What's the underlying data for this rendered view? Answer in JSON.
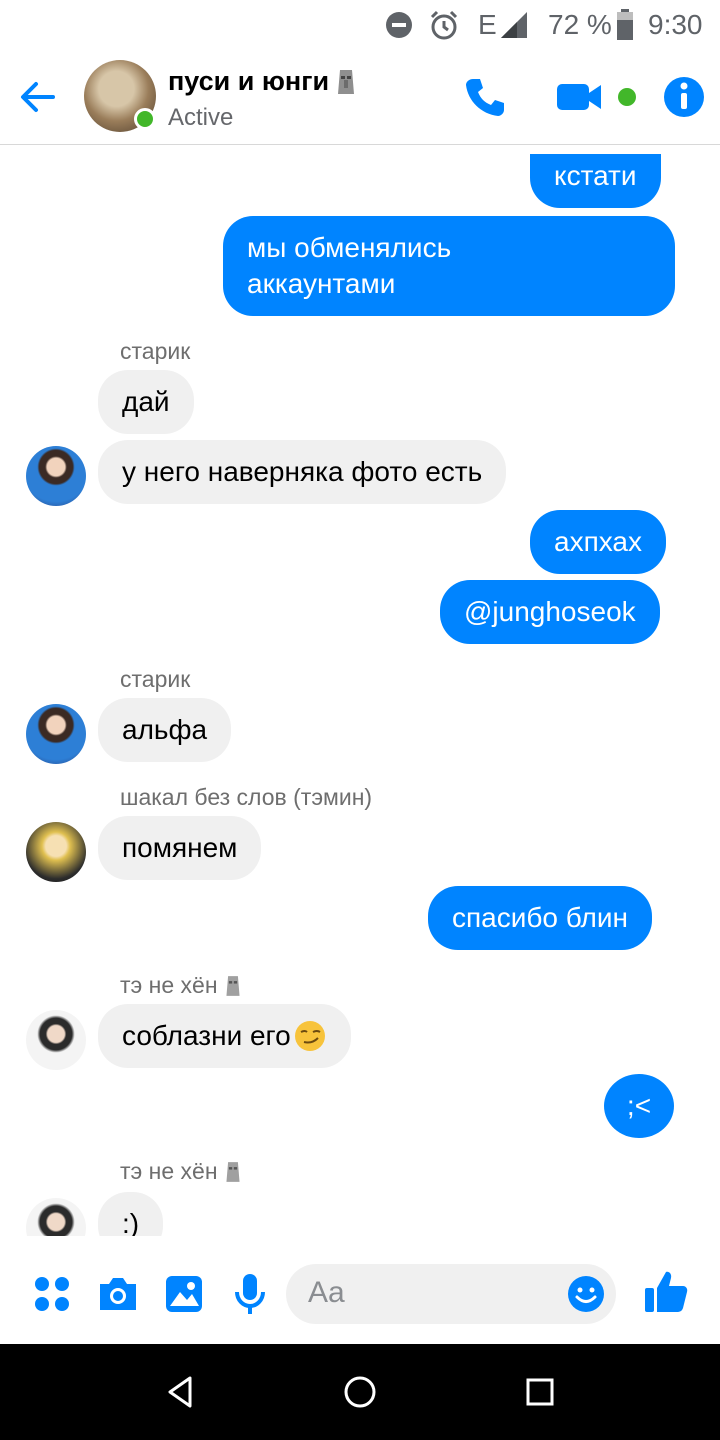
{
  "status_bar": {
    "battery": "72 %",
    "time": "9:30",
    "network": "E"
  },
  "header": {
    "title": "пуси и юнги",
    "status": "Active",
    "colors": {
      "accent": "#0084ff",
      "online": "#42b72a"
    }
  },
  "messages": {
    "m1": "кстати",
    "m2_line1": "мы обменялись",
    "m2_line2": "аккаунтами",
    "s1": "старик",
    "m3": "дай",
    "m4": "у него наверняка фото есть",
    "m5": "ахпхах",
    "m6": "@junghoseok",
    "s2": "старик",
    "m7": "альфа",
    "s3": "шакал без слов (тэмин)",
    "m8": "помянем",
    "m9": "спасибо блин",
    "s4": "тэ не хён",
    "m10": "соблазни его",
    "m11": ";<",
    "s5": "тэ не хён",
    "m12": ":)"
  },
  "composer": {
    "placeholder": "Aa"
  },
  "icons": {
    "back": "arrow-left-icon",
    "call": "phone-icon",
    "video": "video-camera-icon",
    "info": "info-icon",
    "more": "grid-dots-icon",
    "camera": "camera-icon",
    "gallery": "image-icon",
    "mic": "microphone-icon",
    "emoji": "smiley-icon",
    "like": "thumbs-up-icon"
  }
}
